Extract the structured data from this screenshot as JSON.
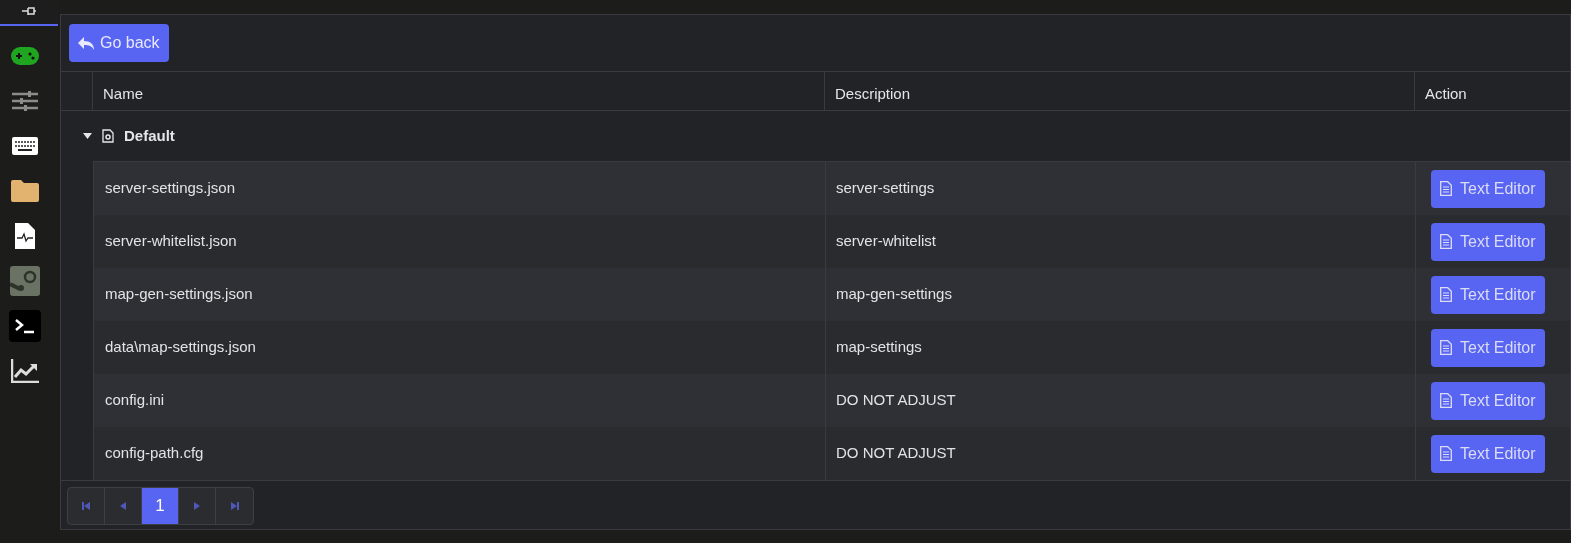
{
  "back_button": {
    "label": "Go back"
  },
  "table": {
    "columns": [
      "Name",
      "Description",
      "Action"
    ],
    "group": {
      "label": "Default",
      "expanded": true
    },
    "rows": [
      {
        "name": "server-settings.json",
        "description": "server-settings",
        "action": "Text Editor"
      },
      {
        "name": "server-whitelist.json",
        "description": "server-whitelist",
        "action": "Text Editor"
      },
      {
        "name": "map-gen-settings.json",
        "description": "map-gen-settings",
        "action": "Text Editor"
      },
      {
        "name": "data\\map-settings.json",
        "description": "map-settings",
        "action": "Text Editor"
      },
      {
        "name": "config.ini",
        "description": "DO NOT ADJUST",
        "action": "Text Editor"
      },
      {
        "name": "config-path.cfg",
        "description": "DO NOT ADJUST",
        "action": "Text Editor"
      }
    ]
  },
  "pagination": {
    "pages": [
      {
        "label": "1",
        "selected": true
      }
    ]
  }
}
